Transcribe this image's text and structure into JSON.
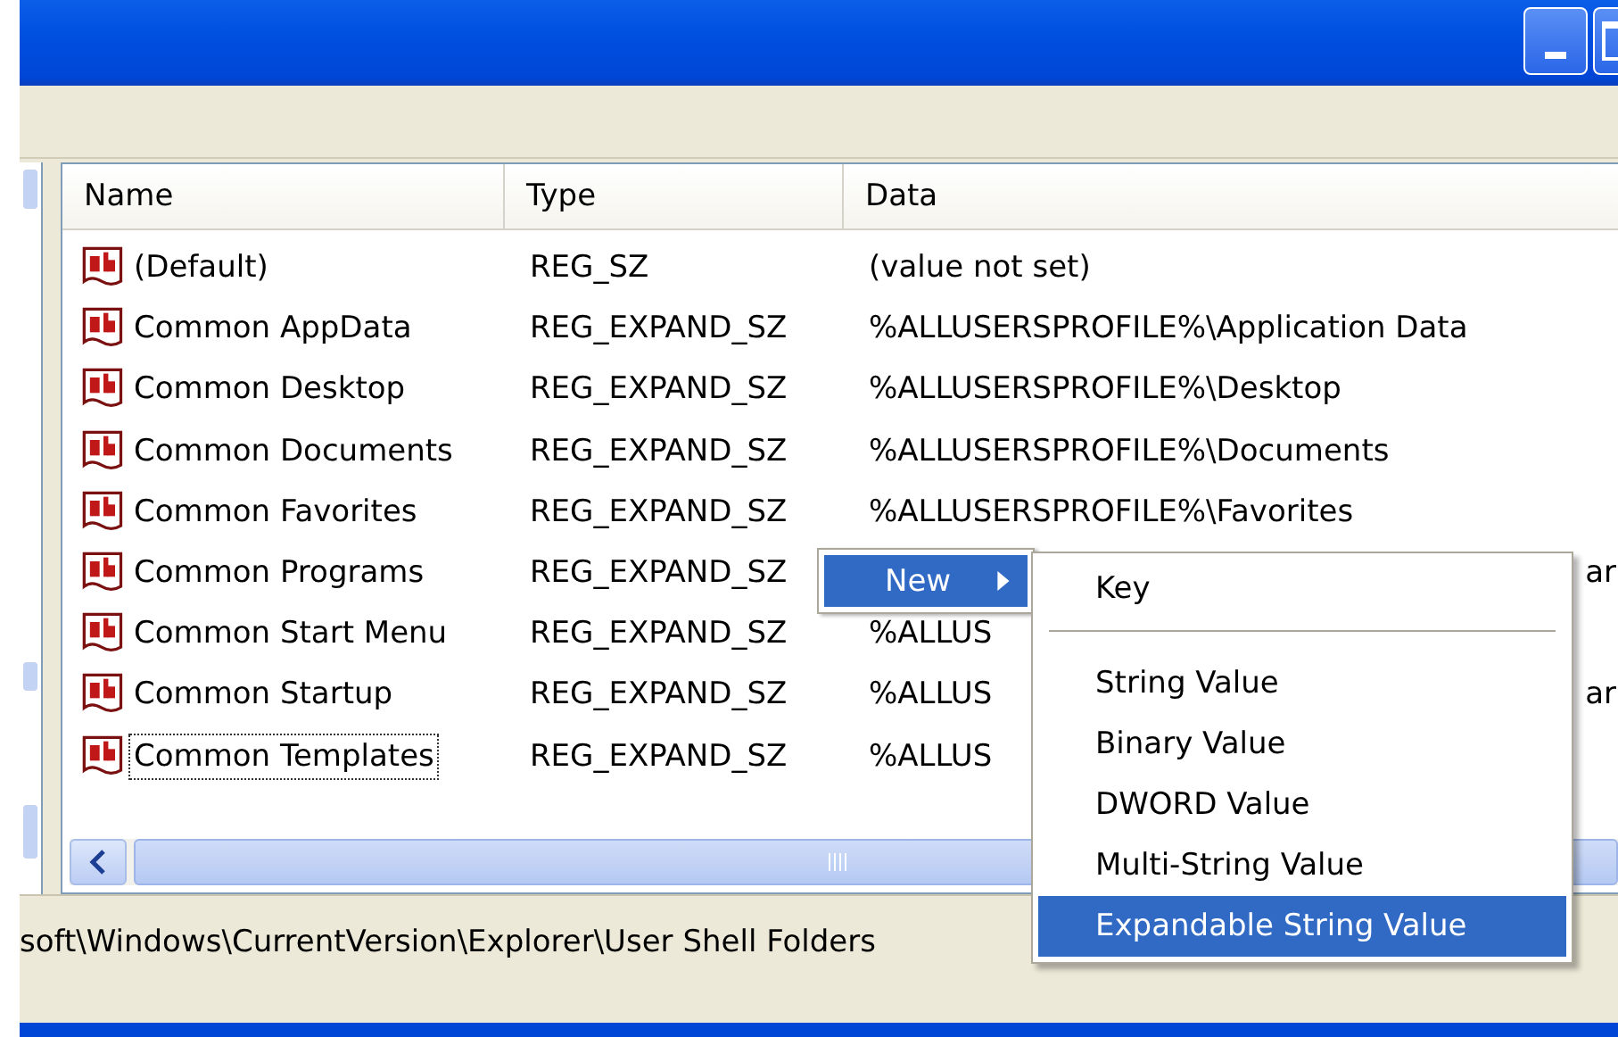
{
  "list": {
    "columns": [
      "Name",
      "Type",
      "Data"
    ],
    "rows": [
      {
        "name": "(Default)",
        "type": "REG_SZ",
        "data": "(value not set)",
        "focused": false
      },
      {
        "name": "Common AppData",
        "type": "REG_EXPAND_SZ",
        "data": "%ALLUSERSPROFILE%\\Application Data",
        "focused": false
      },
      {
        "name": "Common Desktop",
        "type": "REG_EXPAND_SZ",
        "data": "%ALLUSERSPROFILE%\\Desktop",
        "focused": false
      },
      {
        "name": "Common Documents",
        "type": "REG_EXPAND_SZ",
        "data": "%ALLUSERSPROFILE%\\Documents",
        "focused": false
      },
      {
        "name": "Common Favorites",
        "type": "REG_EXPAND_SZ",
        "data": "%ALLUSERSPROFILE%\\Favorites",
        "focused": false
      },
      {
        "name": "Common Programs",
        "type": "REG_EXPAND_SZ",
        "data_tail": "ar",
        "focused": false
      },
      {
        "name": "Common Start Menu",
        "type": "REG_EXPAND_SZ",
        "data": "%ALLUS",
        "focused": false
      },
      {
        "name": "Common Startup",
        "type": "REG_EXPAND_SZ",
        "data": "%ALLUS",
        "data_tail": "ar",
        "focused": false
      },
      {
        "name": "Common Templates",
        "type": "REG_EXPAND_SZ",
        "data": "%ALLUS",
        "focused": true
      }
    ]
  },
  "context_menu": {
    "label": "New",
    "selected": true
  },
  "submenu": {
    "items": [
      {
        "kind": "item",
        "label": "Key",
        "selected": false
      },
      {
        "kind": "separator"
      },
      {
        "kind": "item",
        "label": "String Value",
        "selected": false
      },
      {
        "kind": "item",
        "label": "Binary Value",
        "selected": false
      },
      {
        "kind": "item",
        "label": "DWORD Value",
        "selected": false
      },
      {
        "kind": "item",
        "label": "Multi-String Value",
        "selected": false
      },
      {
        "kind": "item",
        "label": "Expandable String Value",
        "selected": true
      }
    ]
  },
  "status_bar": "soft\\Windows\\CurrentVersion\\Explorer\\User Shell Folders"
}
